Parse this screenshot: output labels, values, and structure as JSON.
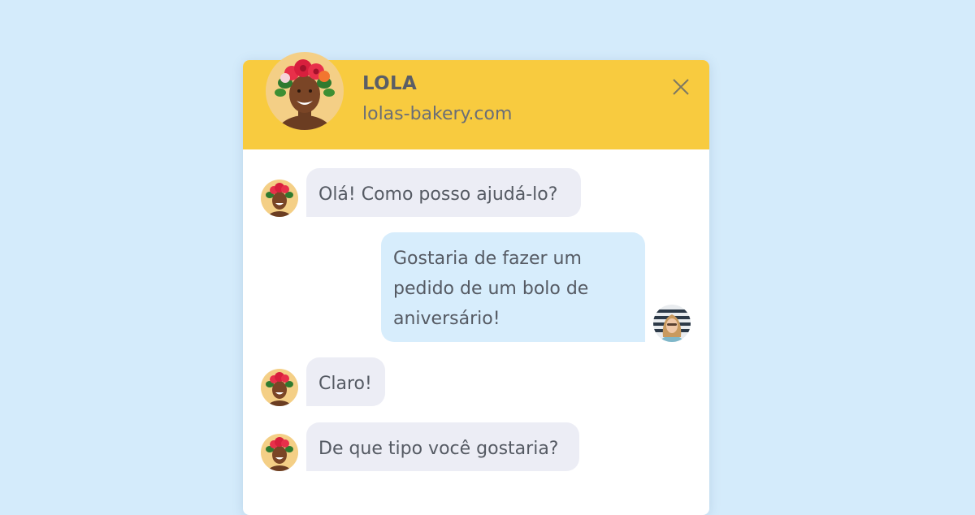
{
  "header": {
    "agent_name": "LOLA",
    "agent_site": "lolas-bakery.com",
    "close_icon": "close-icon"
  },
  "colors": {
    "background": "#d4ebfb",
    "header": "#f8cb3f",
    "agent_bubble": "#ecedf5",
    "user_bubble": "#d7edfc",
    "text": "#555a63"
  },
  "messages": [
    {
      "sender": "agent",
      "text": "Olá! Como posso ajudá-lo?"
    },
    {
      "sender": "user",
      "lines": [
        "Gostaria de fazer um",
        "pedido de um bolo de",
        "aniversário!"
      ]
    },
    {
      "sender": "agent",
      "text": "Claro!"
    },
    {
      "sender": "agent",
      "text": "De que tipo você gostaria?"
    }
  ]
}
